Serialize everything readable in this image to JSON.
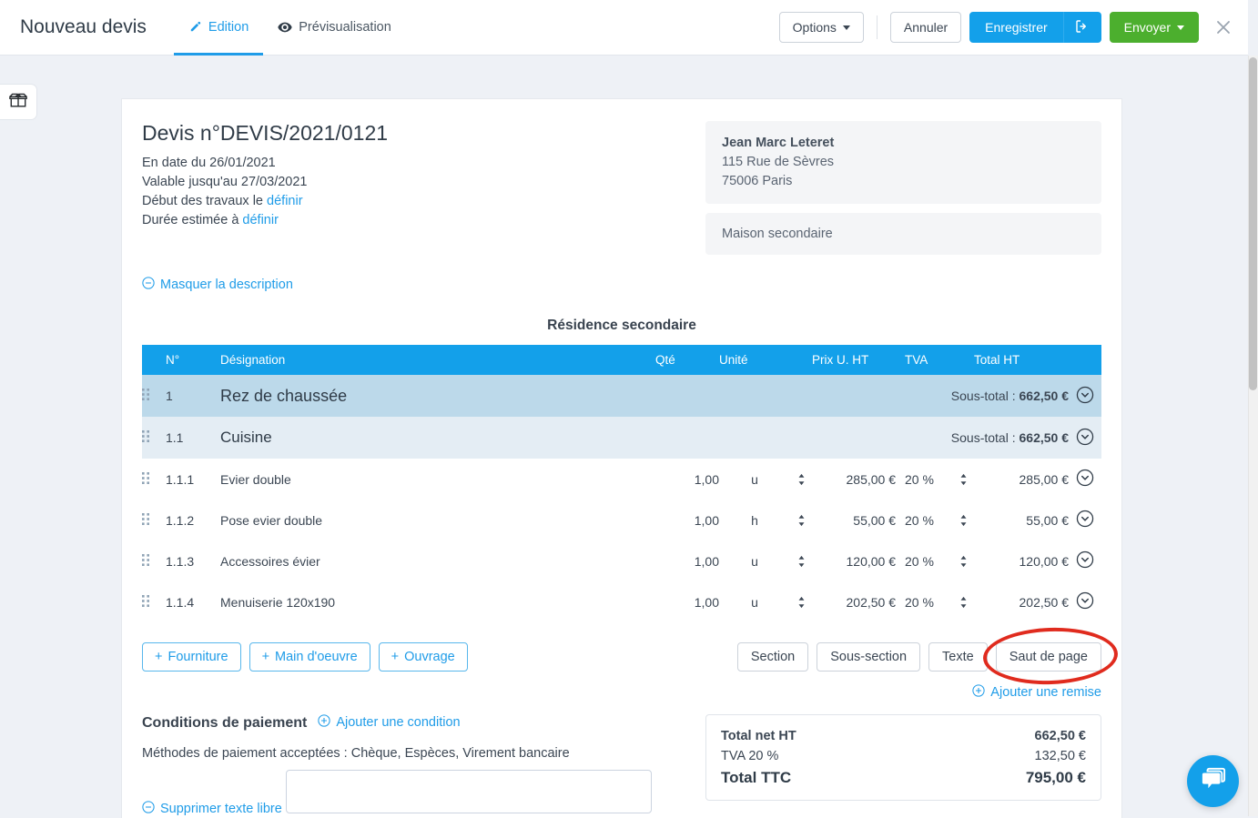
{
  "header": {
    "app_title": "Nouveau devis",
    "tabs": [
      {
        "label": "Edition",
        "icon": "pencil-icon",
        "active": true
      },
      {
        "label": "Prévisualisation",
        "icon": "eye-icon",
        "active": false
      }
    ],
    "options_label": "Options",
    "cancel_label": "Annuler",
    "save_label": "Enregistrer",
    "save_icon": "export-icon",
    "send_label": "Envoyer",
    "close_icon": "close-icon",
    "accent_blue": "#13a0ea",
    "accent_green": "#4caf2e"
  },
  "left_tool": {
    "icon": "open-box-icon"
  },
  "document": {
    "title": "Devis n°DEVIS/2021/0121",
    "meta": {
      "date_line": "En date du 26/01/2021",
      "valid_line": "Valable jusqu'au 27/03/2021",
      "start_prefix": "Début des travaux le ",
      "start_link": "définir",
      "duration_prefix": "Durée estimée à ",
      "duration_link": "définir"
    },
    "client": {
      "name": "Jean Marc Leteret",
      "address": "115 Rue de Sèvres",
      "city": "75006 Paris"
    },
    "site": "Maison secondaire",
    "toggle_description": "Masquer la description",
    "section_heading": "Résidence secondaire"
  },
  "table": {
    "columns": [
      "N°",
      "Désignation",
      "Qté",
      "Unité",
      "Prix U. HT",
      "TVA",
      "Total HT"
    ],
    "subtotal_prefix": "Sous-total : ",
    "rows": [
      {
        "type": "section",
        "num": "1",
        "designation": "Rez de chaussée",
        "subtotal": "662,50 €"
      },
      {
        "type": "subsection",
        "num": "1.1",
        "designation": "Cuisine",
        "subtotal": "662,50 €"
      },
      {
        "type": "item",
        "num": "1.1.1",
        "designation": "Evier double",
        "qte": "1,00",
        "unite": "u",
        "prix": "285,00 €",
        "tva": "20 %",
        "total": "285,00 €"
      },
      {
        "type": "item",
        "num": "1.1.2",
        "designation": "Pose evier double",
        "qte": "1,00",
        "unite": "h",
        "prix": "55,00 €",
        "tva": "20 %",
        "total": "55,00 €"
      },
      {
        "type": "item",
        "num": "1.1.3",
        "designation": "Accessoires évier",
        "qte": "1,00",
        "unite": "u",
        "prix": "120,00 €",
        "tva": "20 %",
        "total": "120,00 €"
      },
      {
        "type": "item",
        "num": "1.1.4",
        "designation": "Menuiserie 120x190",
        "qte": "1,00",
        "unite": "u",
        "prix": "202,50 €",
        "tva": "20 %",
        "total": "202,50 €"
      }
    ]
  },
  "actions": {
    "add_buttons": [
      {
        "label": "Fourniture"
      },
      {
        "label": "Main d'oeuvre"
      },
      {
        "label": "Ouvrage"
      }
    ],
    "structure_buttons": [
      {
        "label": "Section"
      },
      {
        "label": "Sous-section"
      },
      {
        "label": "Texte"
      },
      {
        "label": "Saut de page",
        "highlighted": true
      }
    ],
    "discount_link": "Ajouter une remise",
    "annotation": {
      "shape": "ellipse",
      "color": "#e02b1e",
      "target": "Saut de page"
    }
  },
  "payment": {
    "title": "Conditions de paiement",
    "add_condition": "Ajouter une condition",
    "methods": "Méthodes de paiement acceptées : Chèque, Espèces, Virement bancaire",
    "remove_free_text": "Supprimer texte libre",
    "free_text_value": "",
    "free_text_placeholder": ""
  },
  "totals": {
    "net_ht_label": "Total net HT",
    "net_ht_value": "662,50 €",
    "tva_label": "TVA 20 %",
    "tva_value": "132,50 €",
    "ttc_label": "Total TTC",
    "ttc_value": "795,00 €"
  },
  "chat": {
    "icon": "chat-bubbles-icon"
  }
}
